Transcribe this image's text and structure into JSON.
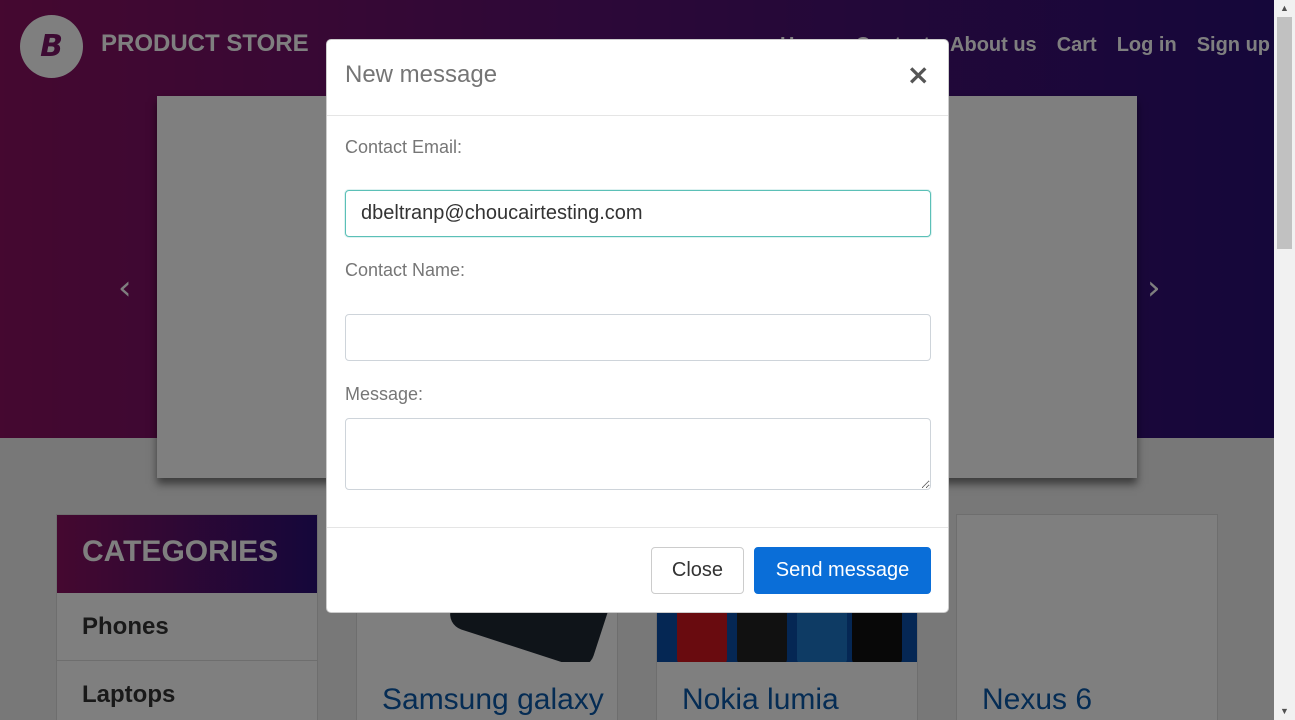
{
  "brand": {
    "name": "PRODUCT STORE",
    "logo_letter": "B"
  },
  "nav": {
    "items": [
      "Home",
      "Contact",
      "About us",
      "Cart",
      "Log in",
      "Sign up"
    ]
  },
  "carousel": {
    "prev_icon": "chevron-left-icon",
    "next_icon": "chevron-right-icon"
  },
  "categories": {
    "title": "CATEGORIES",
    "items": [
      "Phones",
      "Laptops"
    ]
  },
  "products": [
    "Samsung galaxy",
    "Nokia lumia",
    "Nexus 6"
  ],
  "modal": {
    "title": "New message",
    "close_symbol": "×",
    "email_label": "Contact Email:",
    "email_value": "dbeltranp@choucairtesting.com",
    "name_label": "Contact Name:",
    "name_value": "",
    "message_label": "Message:",
    "message_value": "",
    "close_button": "Close",
    "send_button": "Send message"
  },
  "colors": {
    "hero_left": "#8a1060",
    "hero_right": "#2a0f75",
    "primary_button": "#0a6ed8",
    "focus_border": "#5bc0b7"
  }
}
